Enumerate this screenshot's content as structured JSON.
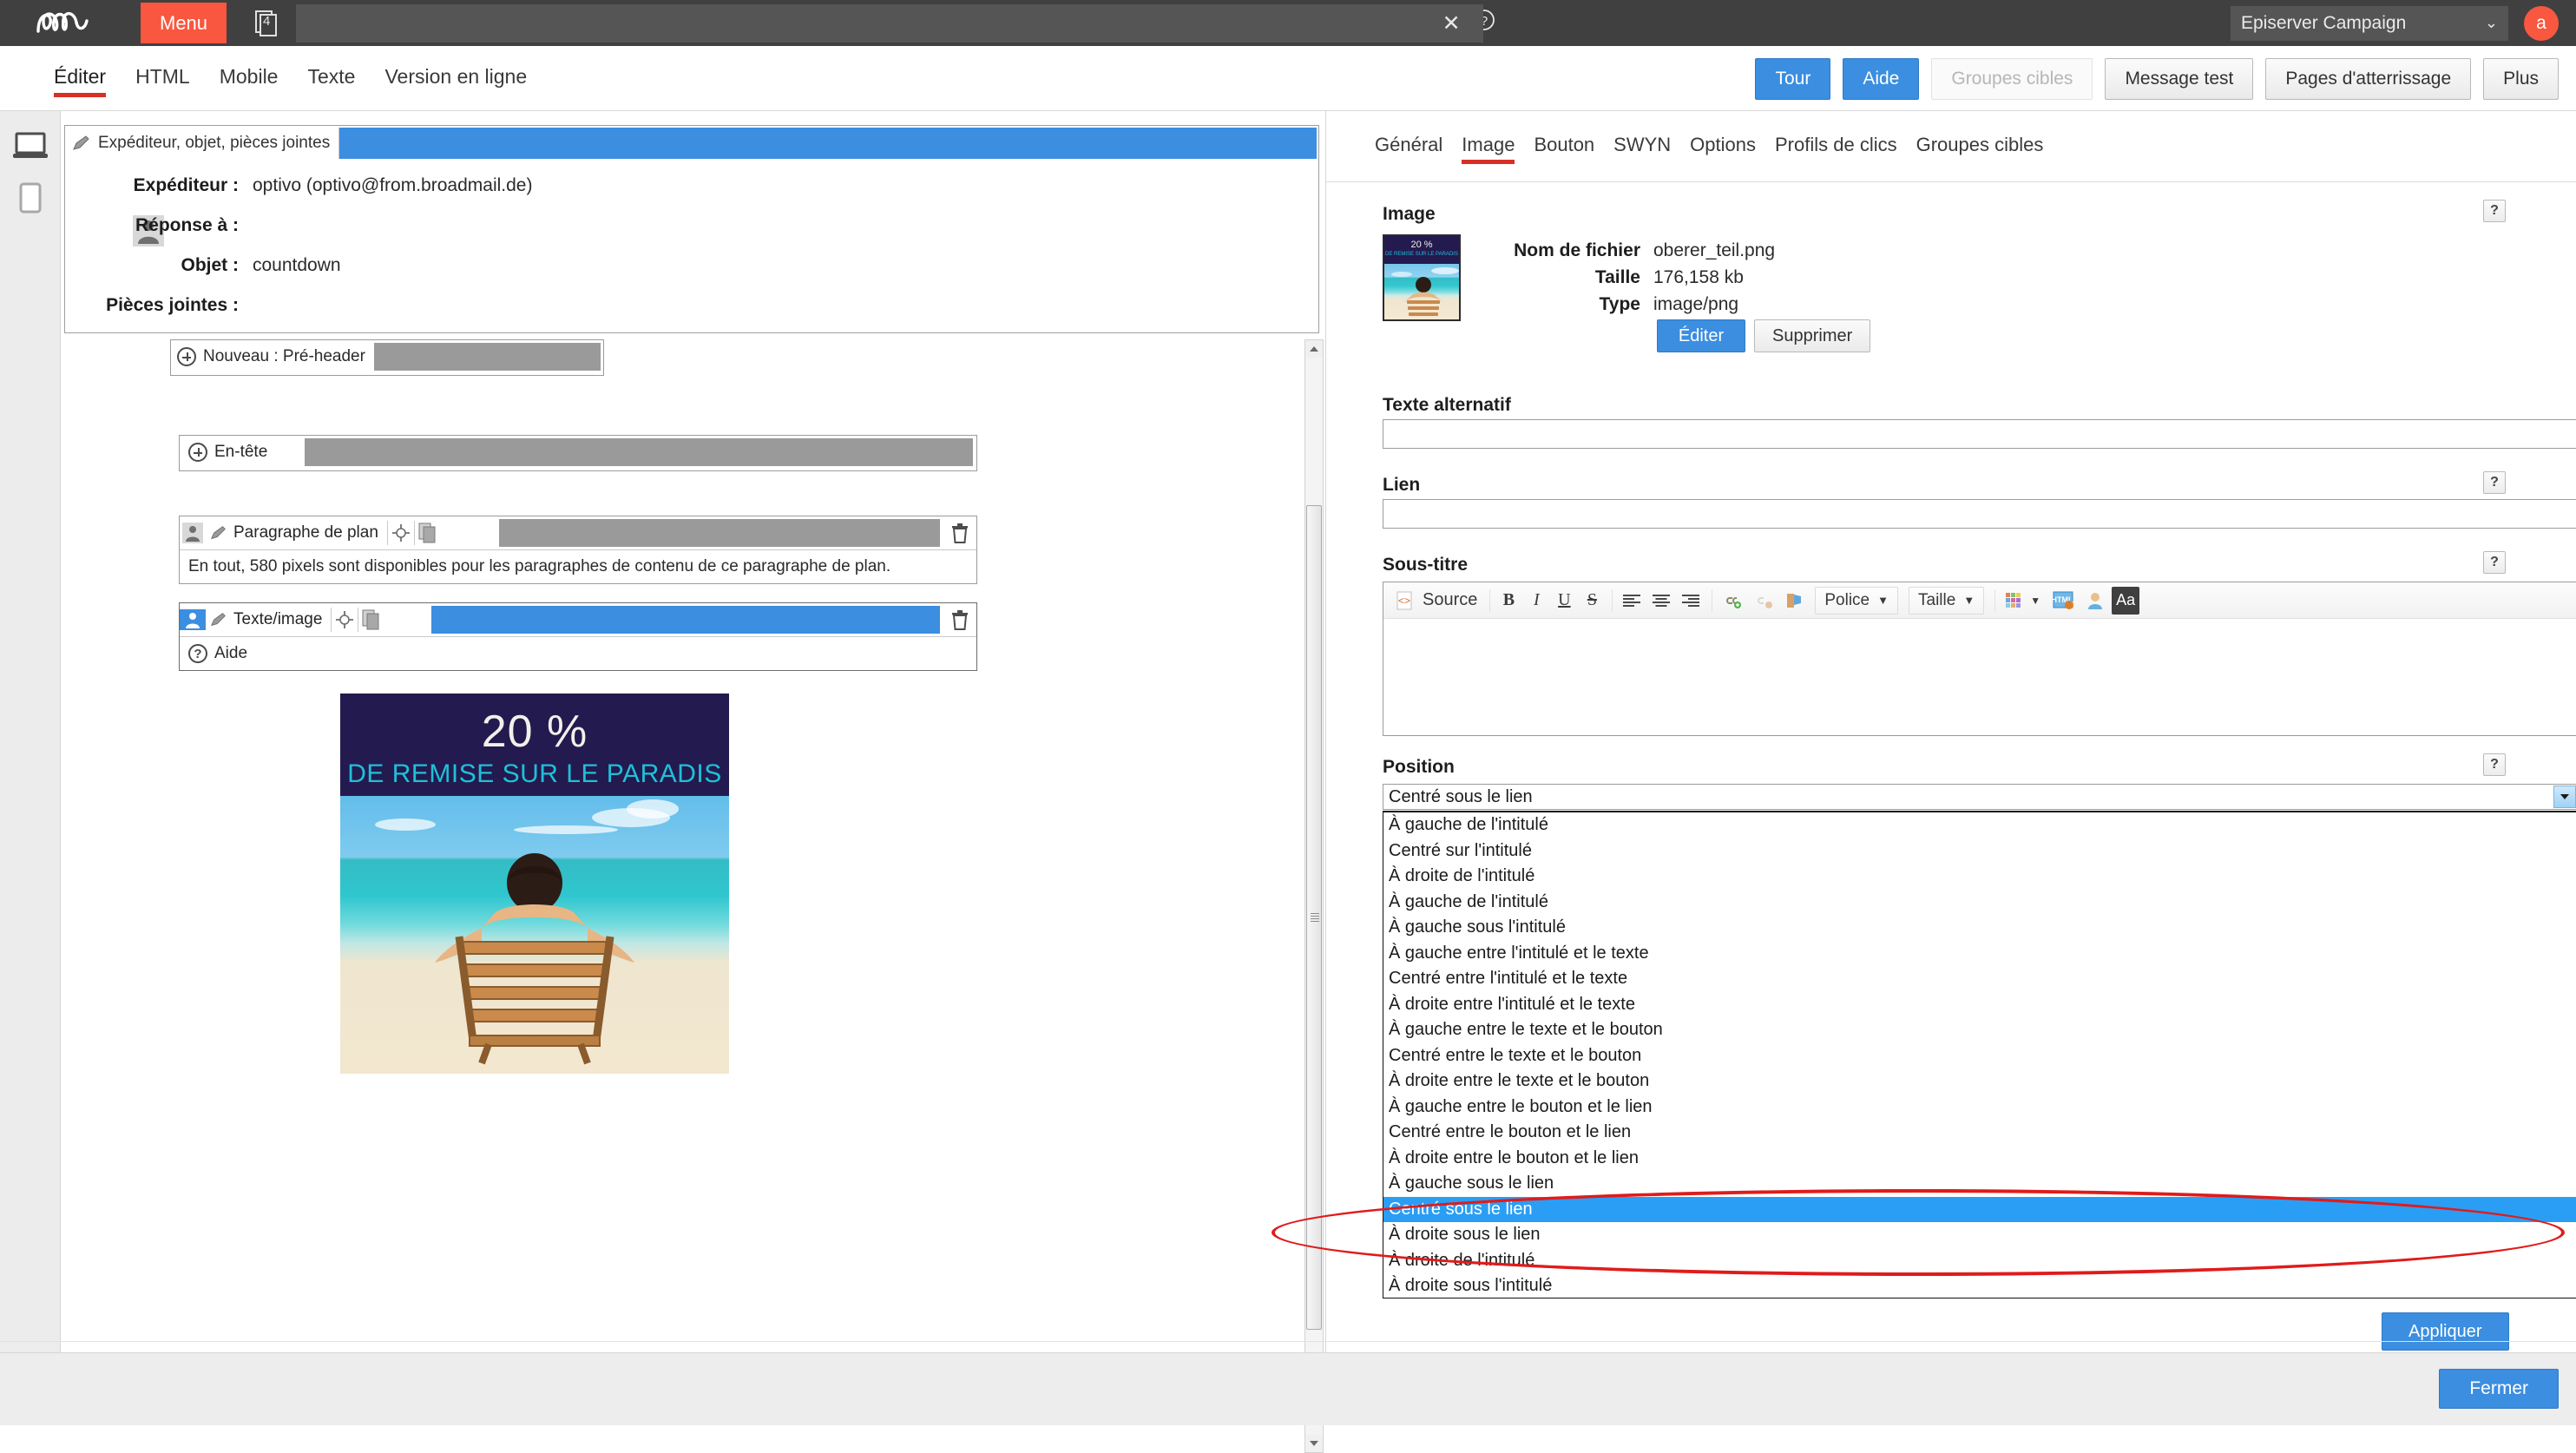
{
  "topbar": {
    "logo_alt": "epi",
    "menu_label": "Menu",
    "doc_count": "4",
    "search_value": "",
    "close_icon": "close-icon",
    "help_icon": "help-icon",
    "client_selected": "Episerver Campaign",
    "avatar_initial": "a"
  },
  "modebar": {
    "tabs": [
      {
        "label": "Éditer",
        "active": true
      },
      {
        "label": "HTML",
        "active": false
      },
      {
        "label": "Mobile",
        "active": false
      },
      {
        "label": "Texte",
        "active": false
      },
      {
        "label": "Version en ligne",
        "active": false
      }
    ],
    "actions": [
      {
        "label": "Tour",
        "style": "primary"
      },
      {
        "label": "Aide",
        "style": "primary"
      },
      {
        "label": "Groupes cibles",
        "style": "disabled"
      },
      {
        "label": "Message test",
        "style": "normal"
      },
      {
        "label": "Pages d'atterrissage",
        "style": "normal"
      },
      {
        "label": "Plus",
        "style": "normal"
      }
    ]
  },
  "devicerail": {
    "desktop_icon": "desktop-preview-icon",
    "mobile_icon": "mobile-preview-icon"
  },
  "editor": {
    "header_card": {
      "title": "Expéditeur, objet, pièces jointes",
      "fields": [
        {
          "label": "Expéditeur :",
          "value": "optivo (optivo@from.broadmail.de)"
        },
        {
          "label": "Réponse à :",
          "value": ""
        },
        {
          "label": "Objet :",
          "value": "countdown"
        },
        {
          "label": "Pièces jointes :",
          "value": ""
        }
      ]
    },
    "preheader_label": "Nouveau : Pré-header",
    "modules": [
      {
        "label": "En-tête",
        "type": "add",
        "body": ""
      },
      {
        "label": "Paragraphe de plan",
        "type": "block",
        "body": "En tout, 580 pixels sont disponibles pour les paragraphes de contenu de ce paragraphe de plan."
      },
      {
        "label": "Texte/image",
        "type": "block-selected",
        "body": "Aide"
      }
    ],
    "banner": {
      "percent": "20 %",
      "subtitle": "DE REMISE SUR LE PARADIS"
    }
  },
  "rightpanel": {
    "tabs": [
      {
        "label": "Général",
        "active": false
      },
      {
        "label": "Image",
        "active": true
      },
      {
        "label": "Bouton",
        "active": false
      },
      {
        "label": "SWYN",
        "active": false
      },
      {
        "label": "Options",
        "active": false
      },
      {
        "label": "Profils de clics",
        "active": false
      },
      {
        "label": "Groupes cibles",
        "active": false
      }
    ],
    "image_section": {
      "label": "Image",
      "help": "?",
      "meta": [
        {
          "key": "Nom de fichier",
          "value": "oberer_teil.png"
        },
        {
          "key": "Taille",
          "value": "176,158 kb"
        },
        {
          "key": "Type",
          "value": "image/png"
        }
      ],
      "edit_button": "Éditer",
      "delete_button": "Supprimer",
      "thumb_percent": "20 %",
      "thumb_subtitle": "DE REMISE SUR LE PARADIS"
    },
    "alt_text": {
      "label": "Texte alternatif",
      "value": ""
    },
    "link": {
      "label": "Lien",
      "value": "",
      "help": "?"
    },
    "subtitle": {
      "label": "Sous-titre",
      "help": "?",
      "toolbar": {
        "source_label": "Source",
        "bold": "B",
        "italic": "I",
        "underline": "U",
        "strike": "S",
        "align_left": "align-left-icon",
        "align_center": "align-center-icon",
        "align_right": "align-right-icon",
        "link": "insert-link-icon",
        "unlink": "remove-link-icon",
        "anchor": "anchor-icon",
        "font_label": "Police",
        "size_label": "Taille",
        "color": "text-color-icon",
        "html": "html-snippet-icon",
        "personalize": "personalization-icon",
        "case": "Aa"
      },
      "content": ""
    },
    "position": {
      "label": "Position",
      "help": "?",
      "selected": "Centré sous le lien",
      "options": [
        "À gauche de l'intitulé",
        "Centré sur l'intitulé",
        "À droite de l'intitulé",
        "À gauche de l'intitulé",
        "À gauche sous l'intitulé",
        "À gauche entre l'intitulé et le texte",
        "Centré entre l'intitulé et le texte",
        "À droite entre l'intitulé et le texte",
        "À gauche entre le texte et le bouton",
        "Centré entre le texte et le bouton",
        "À droite entre le texte et le bouton",
        "À gauche entre le bouton et le lien",
        "Centré entre le bouton et le lien",
        "À droite entre le bouton et le lien",
        "À gauche sous le lien",
        "Centré sous le lien",
        "À droite sous le lien",
        "À droite de l'intitulé",
        "À droite sous l'intitulé"
      ],
      "selected_index": 15
    },
    "apply_button": "Appliquer"
  },
  "footer": {
    "close_button": "Fermer"
  },
  "annotation": {
    "highlight_color": "#e01b1b",
    "shape": "ellipse"
  }
}
